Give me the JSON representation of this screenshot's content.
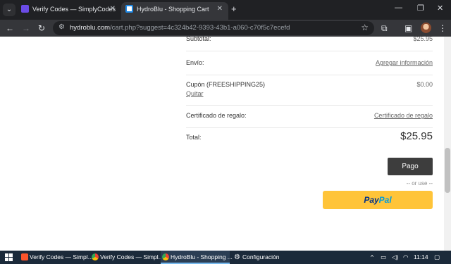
{
  "browser": {
    "tabs": [
      {
        "title": "Verify Codes — SimplyCodes",
        "icon": "simplycodes-icon",
        "color": "#6b4ce6"
      },
      {
        "title": "HydroBlu - Shopping Cart",
        "icon": "hydroblu-icon",
        "color": "#ffffff"
      }
    ],
    "url_host": "hydroblu.com",
    "url_rest": "/cart.php?suggest=4c324b42-9393-43b1-a060-c70f5c7ecefd"
  },
  "cart": {
    "subtotal_label": "Subtotal:",
    "subtotal_value": "$25.95",
    "shipping_label": "Envío:",
    "shipping_link": "Agregar información",
    "coupon_label": "Cupón (FREESHIPPING25)",
    "coupon_remove": "Quitar",
    "coupon_value": "$0.00",
    "gift_label": "Certificado de regalo:",
    "gift_link": "Certificado de regalo",
    "total_label": "Total:",
    "total_value": "$25.95",
    "checkout_button": "Pago",
    "or_use": "-- or use --",
    "paypal_pay": "Pay",
    "paypal_pal": "Pal"
  },
  "taskbar": {
    "items": [
      {
        "label": "Verify Codes — Simpl...",
        "icon": "brave-icon",
        "color": "#fb542b"
      },
      {
        "label": "Verify Codes — Simpl...",
        "icon": "chrome-icon",
        "color": "#4285f4"
      },
      {
        "label": "HydroBlu - Shopping ...",
        "icon": "chrome-icon",
        "color": "#34a853"
      },
      {
        "label": "Configuración",
        "icon": "gear-icon",
        "color": "#ffffff"
      }
    ],
    "time": "11:14"
  }
}
